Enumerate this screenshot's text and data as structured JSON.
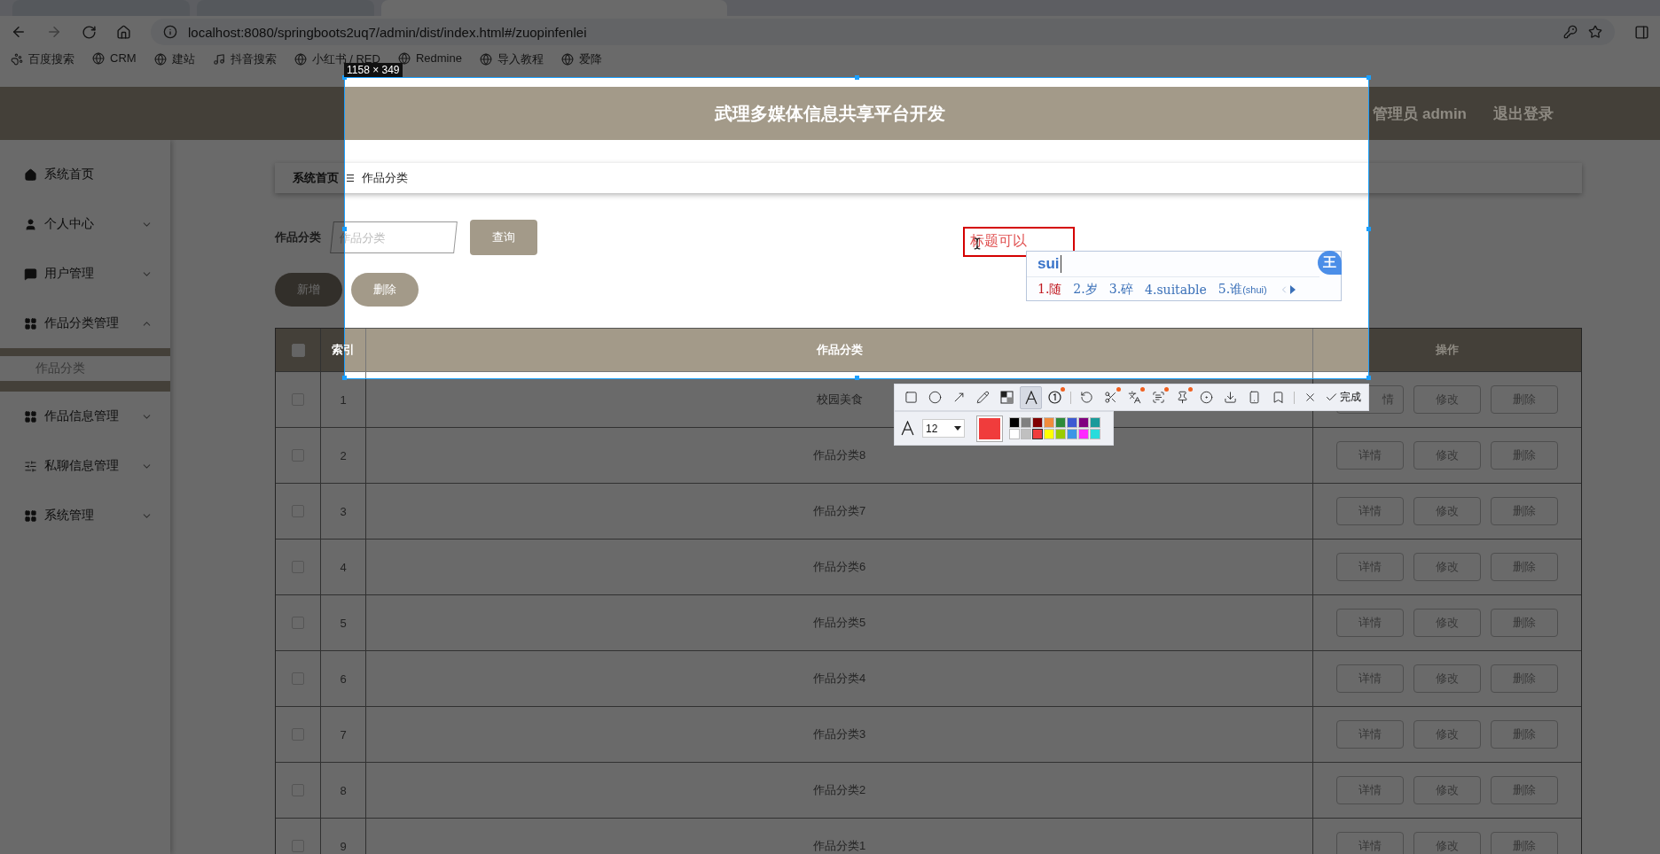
{
  "browser": {
    "tabs": [
      {
        "selected": false
      },
      {
        "selected": false
      },
      {
        "selected": true
      }
    ],
    "url": "localhost:8080/springboots2uq7/admin/dist/index.html#/zuopinfenlei",
    "bookmarks": [
      "百度搜索",
      "CRM",
      "建站",
      "抖音搜索",
      "小红书 / RED",
      "Redmine",
      "导入教程",
      "爱降"
    ]
  },
  "header": {
    "title": "武理多媒体信息共享平台开发",
    "user": "管理员 admin",
    "logout": "退出登录"
  },
  "sidebar": {
    "items": [
      {
        "label": "系统首页"
      },
      {
        "label": "个人中心",
        "expanded": false
      },
      {
        "label": "用户管理",
        "expanded": false
      },
      {
        "label": "作品分类管理",
        "expanded": true,
        "children": [
          {
            "label": "作品分类"
          }
        ]
      },
      {
        "label": "作品信息管理",
        "expanded": false
      },
      {
        "label": "私聊信息管理",
        "expanded": false
      },
      {
        "label": "系统管理",
        "expanded": false
      }
    ]
  },
  "breadcrumb": {
    "home": "系统首页",
    "current": "作品分类"
  },
  "search": {
    "label": "作品分类",
    "placeholder": "作品分类",
    "button": "查询"
  },
  "actions": [
    "新增",
    "删除"
  ],
  "table": {
    "header_checked": false,
    "columns": [
      "索引",
      "作品分类",
      "操作"
    ],
    "rows": [
      {
        "index": "1",
        "name": "校园美食",
        "checked": false,
        "actions": [
          {
            "label": "情",
            "clipped": true
          },
          {
            "label": "修改"
          },
          {
            "label": "删除"
          }
        ]
      },
      {
        "index": "2",
        "name": "作品分类8",
        "checked": false,
        "actions": [
          {
            "label": "详情"
          },
          {
            "label": "修改"
          },
          {
            "label": "删除"
          }
        ]
      },
      {
        "index": "3",
        "name": "作品分类7",
        "checked": false,
        "actions": [
          {
            "label": "详情"
          },
          {
            "label": "修改"
          },
          {
            "label": "删除"
          }
        ]
      },
      {
        "index": "4",
        "name": "作品分类6",
        "checked": false,
        "actions": [
          {
            "label": "详情"
          },
          {
            "label": "修改"
          },
          {
            "label": "删除"
          }
        ]
      },
      {
        "index": "5",
        "name": "作品分类5",
        "checked": false,
        "actions": [
          {
            "label": "详情"
          },
          {
            "label": "修改"
          },
          {
            "label": "删除"
          }
        ]
      },
      {
        "index": "6",
        "name": "作品分类4",
        "checked": false,
        "actions": [
          {
            "label": "详情"
          },
          {
            "label": "修改"
          },
          {
            "label": "删除"
          }
        ]
      },
      {
        "index": "7",
        "name": "作品分类3",
        "checked": false,
        "actions": [
          {
            "label": "详情"
          },
          {
            "label": "修改"
          },
          {
            "label": "删除"
          }
        ]
      },
      {
        "index": "8",
        "name": "作品分类2",
        "checked": false,
        "actions": [
          {
            "label": "详情"
          },
          {
            "label": "修改"
          },
          {
            "label": "删除"
          }
        ]
      },
      {
        "index": "9",
        "name": "作品分类1",
        "checked": false,
        "actions": [
          {
            "label": "详情"
          },
          {
            "label": "修改"
          },
          {
            "label": "删除"
          }
        ]
      }
    ]
  },
  "capture": {
    "size_label": "1158 × 349",
    "annotation": "标题可以"
  },
  "ime": {
    "input": "sui",
    "logo": "王",
    "candidates": [
      {
        "label": "1.随",
        "selected": true
      },
      {
        "label": "2.岁",
        "selected": false
      },
      {
        "label": "3.碎",
        "selected": false
      },
      {
        "label": "4.suitable",
        "selected": false
      },
      {
        "label": "5.谁",
        "hint": "(shui)",
        "selected": false
      }
    ]
  },
  "toolbar": {
    "groups": [
      {
        "tools": [
          {
            "kind": "rectangle",
            "selected": false,
            "badge": false
          },
          {
            "kind": "ellipse",
            "selected": false,
            "badge": false
          },
          {
            "kind": "arrow",
            "selected": false,
            "badge": false
          },
          {
            "kind": "pencil",
            "selected": false,
            "badge": false
          },
          {
            "kind": "mosaic",
            "selected": false,
            "badge": false
          },
          {
            "kind": "text",
            "selected": true,
            "badge": false
          },
          {
            "kind": "number",
            "selected": false,
            "badge": true
          }
        ]
      },
      {
        "tools": [
          {
            "kind": "undo",
            "selected": false,
            "badge": false
          },
          {
            "kind": "scissors",
            "selected": false,
            "badge": true
          },
          {
            "kind": "translate",
            "selected": false,
            "badge": true
          },
          {
            "kind": "scan",
            "selected": false,
            "badge": true
          },
          {
            "kind": "pin",
            "selected": false,
            "badge": true
          },
          {
            "kind": "record",
            "selected": false,
            "badge": false
          },
          {
            "kind": "download",
            "selected": false,
            "badge": false
          },
          {
            "kind": "phone",
            "selected": false,
            "badge": false
          },
          {
            "kind": "bookmark",
            "selected": false,
            "badge": false
          }
        ]
      },
      {
        "tools": [
          {
            "kind": "close",
            "selected": false,
            "badge": false
          }
        ]
      }
    ],
    "done": "完成",
    "font_size": "12",
    "palette": [
      {
        "color": "#000000",
        "selected": false
      },
      {
        "color": "#808080",
        "selected": false
      },
      {
        "color": "#800000",
        "selected": false
      },
      {
        "color": "#f08c3c",
        "selected": false
      },
      {
        "color": "#2e8b3a",
        "selected": false
      },
      {
        "color": "#3c5ad2",
        "selected": false
      },
      {
        "color": "#800080",
        "selected": false
      },
      {
        "color": "#1a9a9a",
        "selected": false
      },
      {
        "color": "#ffffff",
        "selected": false
      },
      {
        "color": "#c0c0c0",
        "selected": false
      },
      {
        "color": "#f03c3c",
        "selected": true
      },
      {
        "color": "#ffff00",
        "selected": false
      },
      {
        "color": "#99cc00",
        "selected": false
      },
      {
        "color": "#3c96e6",
        "selected": false
      },
      {
        "color": "#ff28ff",
        "selected": false
      },
      {
        "color": "#28dcdc",
        "selected": false
      }
    ]
  }
}
